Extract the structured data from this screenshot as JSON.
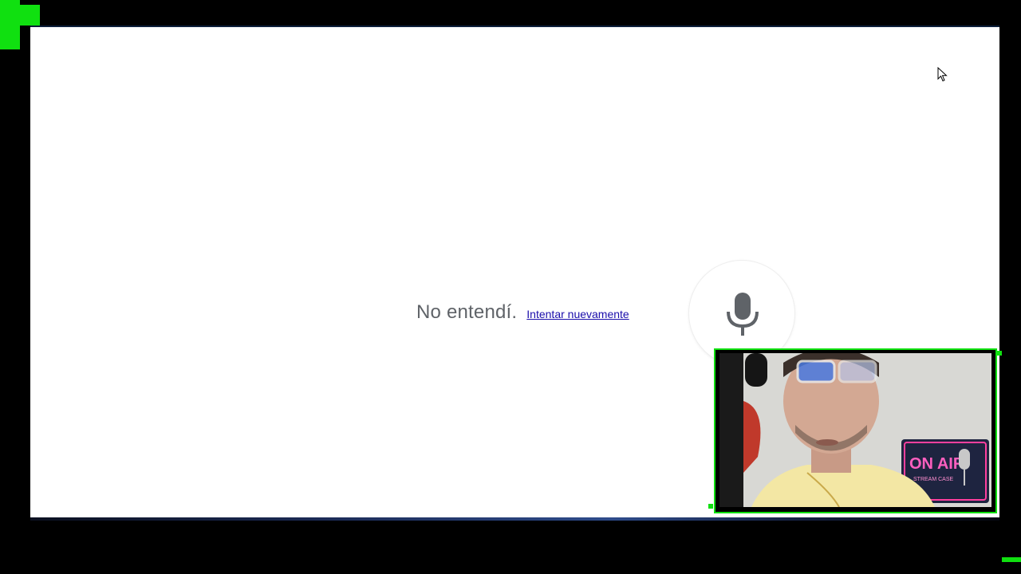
{
  "voice_search": {
    "message": "No entendí.",
    "retry_label": "Intentar nuevamente"
  },
  "icons": {
    "microphone": "microphone-icon",
    "cursor": "mouse-pointer-icon"
  },
  "webcam": {
    "sign_text": "ON AIR",
    "sign_subtext": "STREAM CASE"
  },
  "colors": {
    "overlay_accent": "#10e010",
    "message_text": "#5f6368",
    "link": "#1a0dab",
    "mic": "#5f6368"
  }
}
